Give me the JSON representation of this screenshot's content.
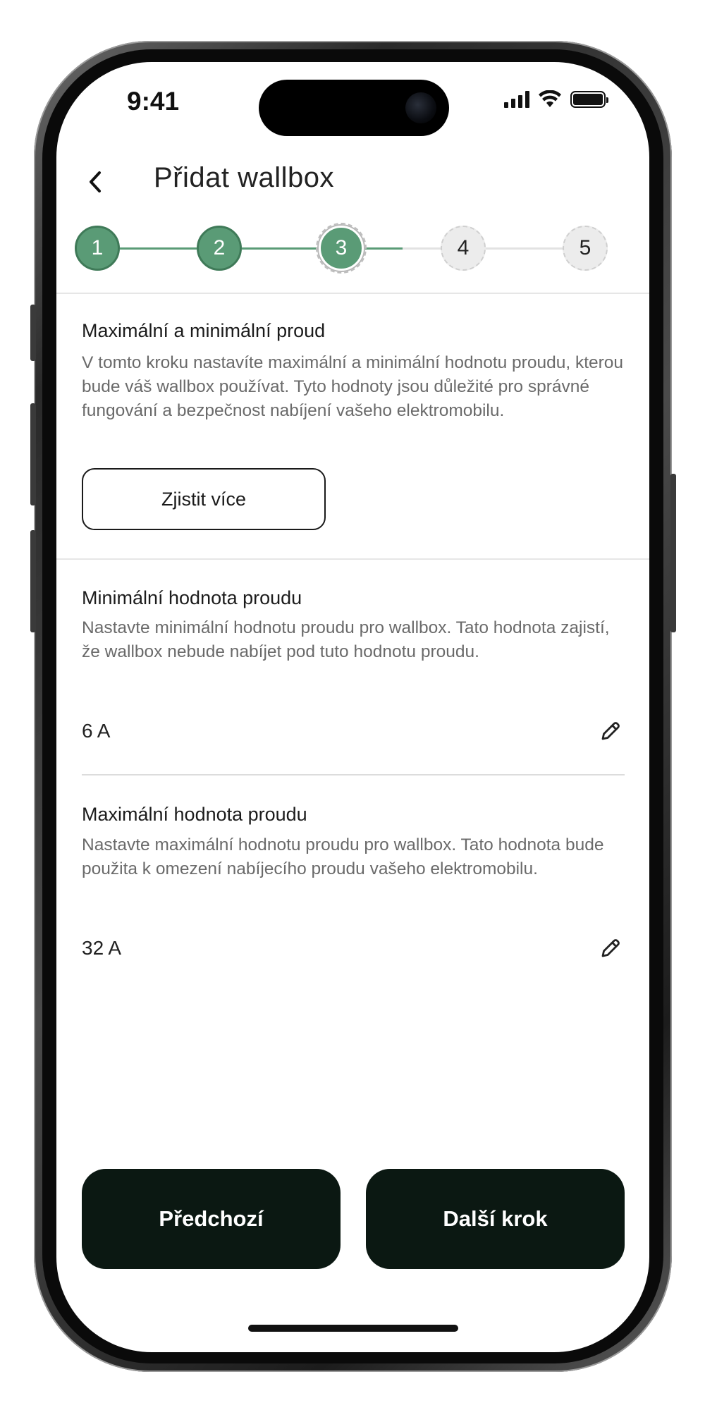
{
  "status_bar": {
    "time": "9:41"
  },
  "header": {
    "title": "Přidat wallbox"
  },
  "stepper": {
    "steps": [
      {
        "label": "1",
        "state": "done"
      },
      {
        "label": "2",
        "state": "done"
      },
      {
        "label": "3",
        "state": "active"
      },
      {
        "label": "4",
        "state": "todo"
      },
      {
        "label": "5",
        "state": "todo"
      }
    ]
  },
  "intro": {
    "title": "Maximální a minimální proud",
    "description": "V tomto kroku nastavíte maximální a minimální hodnotu proudu, kterou bude váš wallbox používat. Tyto hodnoty jsou důležité pro správné fungování a bezpečnost nabíjení vašeho elektromobilu.",
    "learn_more_label": "Zjistit více"
  },
  "min_current": {
    "title": "Minimální hodnota proudu",
    "description": "Nastavte minimální hodnotu proudu pro wallbox. Tato hodnota zajistí, že wallbox nebude nabíjet pod tuto hodnotu proudu.",
    "value": "6 A"
  },
  "max_current": {
    "title": "Maximální hodnota proudu",
    "description": "Nastavte maximální hodnotu proudu pro wallbox. Tato hodnota bude použita k omezení nabíjecího proudu vašeho elektromobilu.",
    "value": "32 A"
  },
  "footer": {
    "previous_label": "Předchozí",
    "next_label": "Další krok"
  },
  "colors": {
    "accent_green": "#5a9b76",
    "button_dark": "#0b1812"
  }
}
